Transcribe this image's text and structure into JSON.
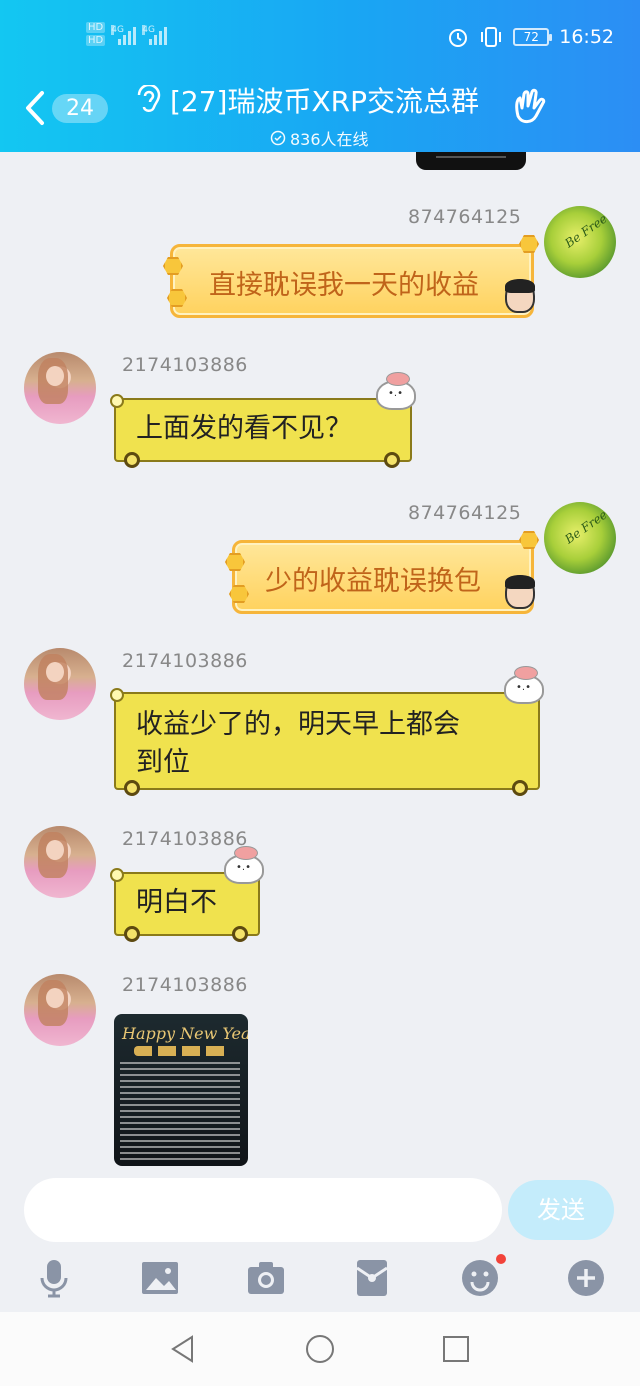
{
  "status_bar": {
    "hd_top": "HD",
    "hd_bottom": "HD",
    "net1": "4G",
    "net2": "4G",
    "battery": "72",
    "time": "16:52"
  },
  "header": {
    "unread_count": "24",
    "title": "[27]瑞波币XRP交流总群",
    "online": "836人在线"
  },
  "messages": [
    {
      "id": "m1",
      "sender": "874764125",
      "side": "right",
      "text": "直接耽误我一天的收益"
    },
    {
      "id": "m2",
      "sender": "2174103886",
      "side": "left",
      "text": "上面发的看不见？"
    },
    {
      "id": "m3",
      "sender": "874764125",
      "side": "right",
      "text": "少的收益耽误换包"
    },
    {
      "id": "m4",
      "sender": "2174103886",
      "side": "left",
      "text": "收益少了的，明天早上都会\n到位"
    },
    {
      "id": "m5",
      "sender": "2174103886",
      "side": "left",
      "text": "明白不"
    },
    {
      "id": "m6",
      "sender": "2174103886",
      "side": "left",
      "image_caption": "Happy New Year"
    }
  ],
  "avatar_leaf_text": "Be Free",
  "input": {
    "placeholder": "",
    "send_label": "发送"
  },
  "toolbar_icons": [
    "mic-icon",
    "image-icon",
    "camera-icon",
    "red-packet-icon",
    "emoji-icon",
    "plus-icon"
  ],
  "colors": {
    "header_start": "#13c7f2",
    "header_end": "#2c8ef4",
    "send_button": "#c4ecfb"
  }
}
